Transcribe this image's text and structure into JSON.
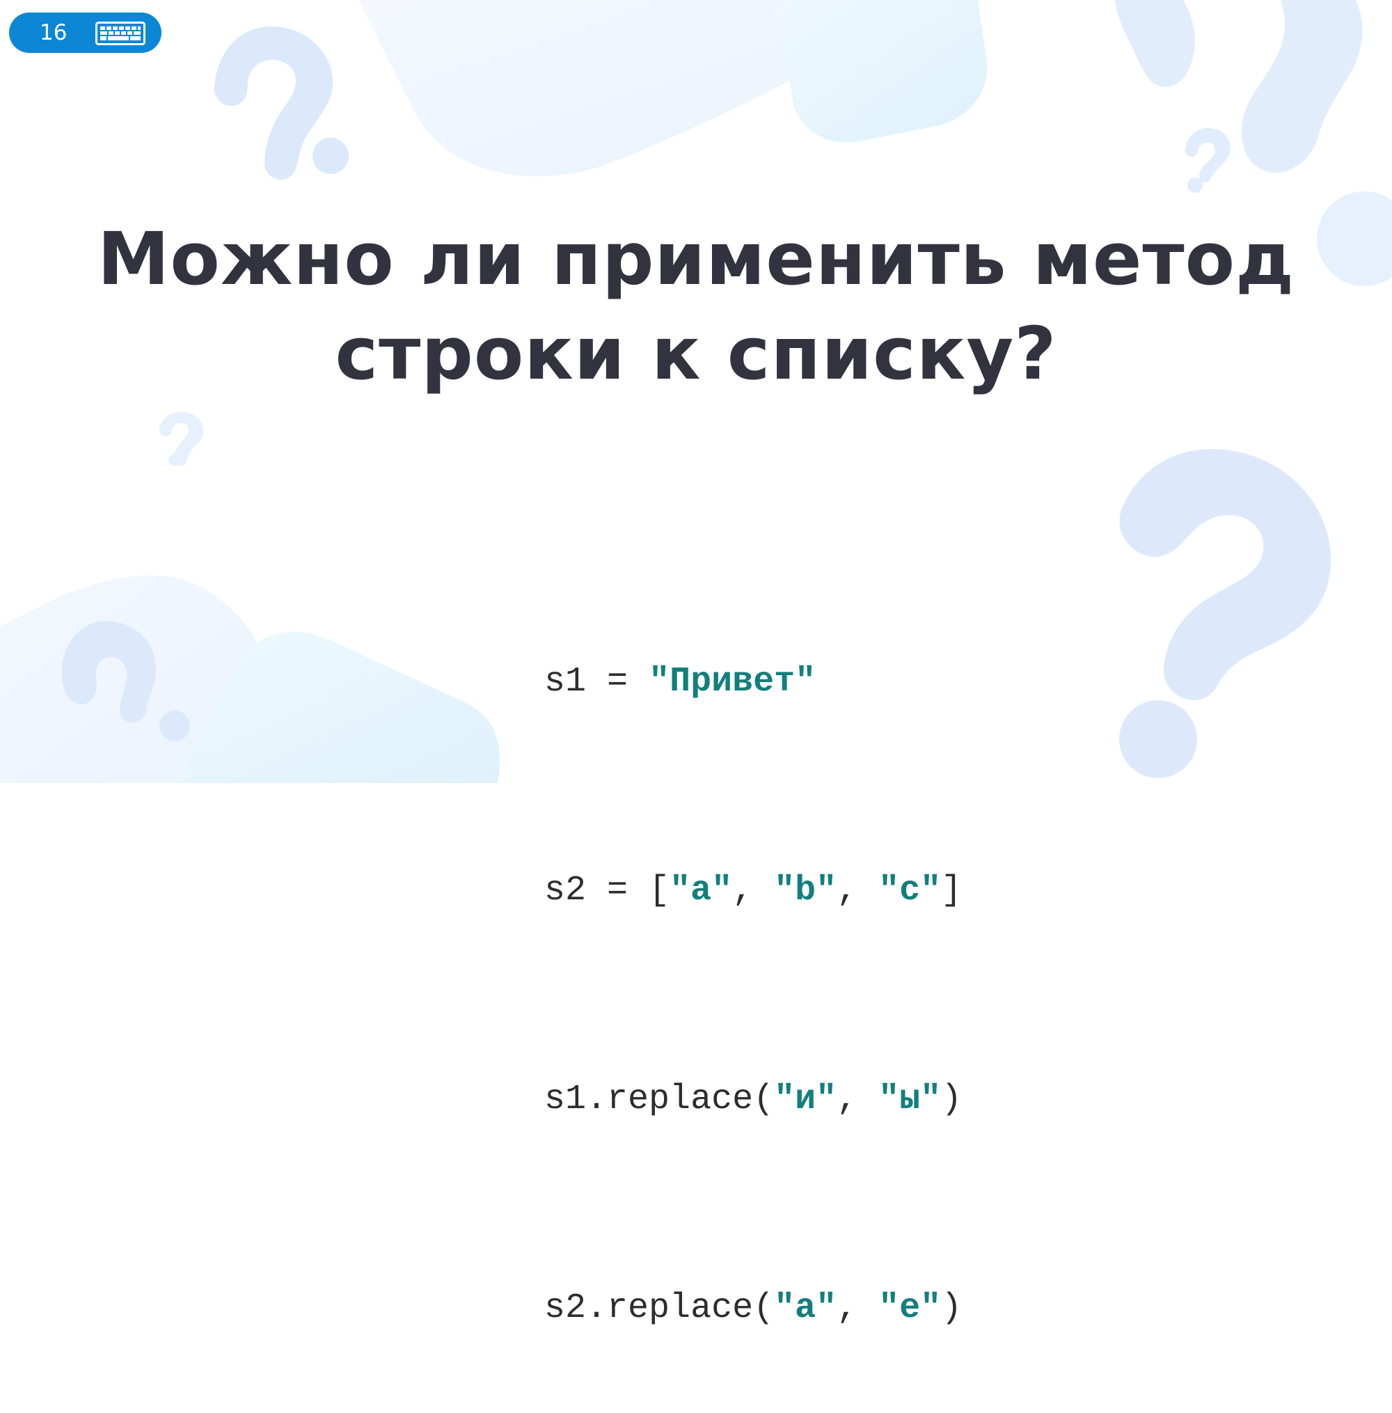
{
  "slide": {
    "number": "16",
    "badge_icon": "keyboard-icon",
    "badge_color": "#0b87d6"
  },
  "title": {
    "line1": "Можно ли применить метод",
    "line2": "строки к списку?"
  },
  "code": {
    "lines": [
      {
        "segments": [
          {
            "text": "s1 = ",
            "type": "plain"
          },
          {
            "text": "\"Привет\"",
            "type": "string"
          }
        ]
      },
      {
        "segments": [
          {
            "text": "s2 = [",
            "type": "plain"
          },
          {
            "text": "\"a\"",
            "type": "string"
          },
          {
            "text": ", ",
            "type": "plain"
          },
          {
            "text": "\"b\"",
            "type": "string"
          },
          {
            "text": ", ",
            "type": "plain"
          },
          {
            "text": "\"c\"",
            "type": "string"
          },
          {
            "text": "]",
            "type": "plain"
          }
        ]
      },
      {
        "segments": [
          {
            "text": "s1.replace(",
            "type": "plain"
          },
          {
            "text": "\"и\"",
            "type": "string"
          },
          {
            "text": ", ",
            "type": "plain"
          },
          {
            "text": "\"ы\"",
            "type": "string"
          },
          {
            "text": ")",
            "type": "plain"
          }
        ]
      },
      {
        "segments": [
          {
            "text": "s2.replace(",
            "type": "plain"
          },
          {
            "text": "\"a\"",
            "type": "string"
          },
          {
            "text": ", ",
            "type": "plain"
          },
          {
            "text": "\"e\"",
            "type": "string"
          },
          {
            "text": ")",
            "type": "plain"
          }
        ]
      }
    ]
  },
  "colors": {
    "title": "#33323f",
    "code_text": "#2d2d2d",
    "code_string": "#137f7c",
    "decoration": "#dbe9fb"
  }
}
